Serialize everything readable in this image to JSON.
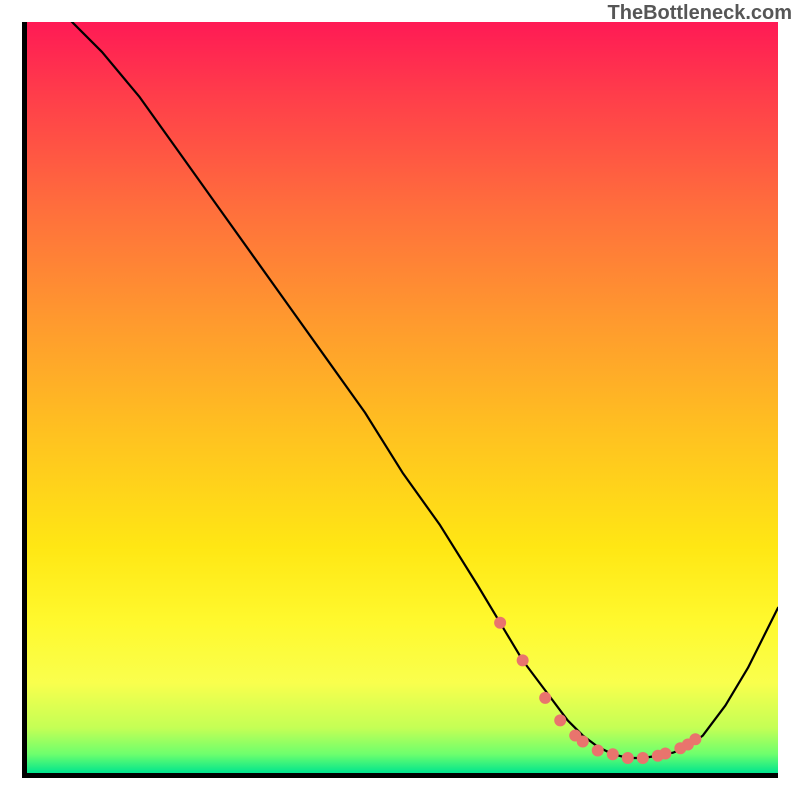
{
  "attribution": "TheBottleneck.com",
  "gradient_stops": [
    {
      "offset": 0,
      "color": "#ff1a55"
    },
    {
      "offset": 0.1,
      "color": "#ff3e4a"
    },
    {
      "offset": 0.25,
      "color": "#ff6f3c"
    },
    {
      "offset": 0.4,
      "color": "#ff9a2e"
    },
    {
      "offset": 0.55,
      "color": "#ffc220"
    },
    {
      "offset": 0.7,
      "color": "#ffe714"
    },
    {
      "offset": 0.8,
      "color": "#fff92e"
    },
    {
      "offset": 0.88,
      "color": "#f9ff4d"
    },
    {
      "offset": 0.94,
      "color": "#c4ff55"
    },
    {
      "offset": 0.975,
      "color": "#6dff6d"
    },
    {
      "offset": 1.0,
      "color": "#00e58e"
    }
  ],
  "chart_data": {
    "type": "line",
    "title": "",
    "xlabel": "",
    "ylabel": "",
    "xlim": [
      0,
      100
    ],
    "ylim": [
      0,
      100
    ],
    "series": [
      {
        "name": "bottleneck-curve",
        "color": "#000000",
        "stroke_width": 2.2,
        "x": [
          0,
          5,
          10,
          15,
          20,
          25,
          30,
          35,
          40,
          45,
          50,
          55,
          60,
          63,
          66,
          69,
          72,
          74,
          76,
          78,
          80,
          82,
          84,
          86,
          88,
          90,
          93,
          96,
          100
        ],
        "y": [
          105,
          101,
          96,
          90,
          83,
          76,
          69,
          62,
          55,
          48,
          40,
          33,
          25,
          20,
          15,
          11,
          7,
          5,
          3.5,
          2.5,
          2,
          2,
          2.3,
          2.7,
          3.5,
          5,
          9,
          14,
          22
        ]
      },
      {
        "name": "optimal-range-markers",
        "type": "scatter",
        "color": "#e9746d",
        "marker_radius": 6,
        "x": [
          63,
          66,
          69,
          71,
          73,
          74,
          76,
          78,
          80,
          82,
          84,
          85,
          87,
          88,
          89
        ],
        "y": [
          20,
          15,
          10,
          7,
          5,
          4.2,
          3,
          2.5,
          2,
          2,
          2.3,
          2.6,
          3.3,
          3.8,
          4.5
        ]
      }
    ]
  }
}
